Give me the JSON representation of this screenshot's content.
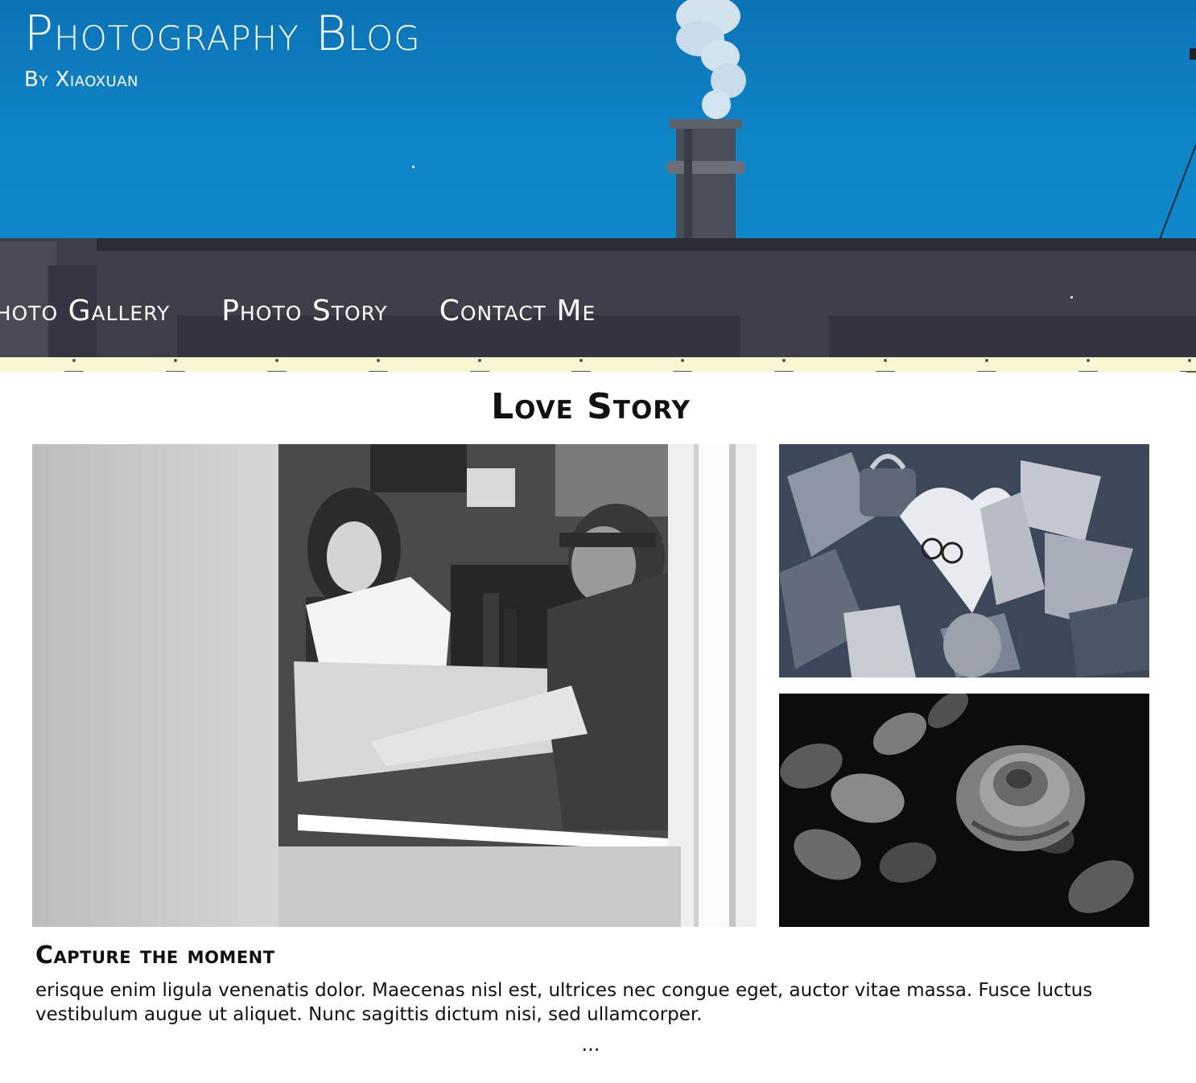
{
  "header": {
    "title": "Photography Blog",
    "subtitle": "By Xiaoxuan"
  },
  "nav": {
    "items": [
      "Photo Gallery",
      "Photo Story",
      "Contact Me"
    ]
  },
  "main": {
    "section_title": "Love Story",
    "post_title": "Capture the moment",
    "post_body": "erisque enim ligula venenatis dolor. Maecenas nisl est, ultrices nec congue eget, auctor vitae massa. Fusce luctus vestibulum augue ut aliquet. Nunc sagittis dictum nisi, sed ullamcorper.",
    "more": "..."
  },
  "colors": {
    "sky": "#0e86c8",
    "strip": "#f7f8d2",
    "text": "#111111"
  }
}
